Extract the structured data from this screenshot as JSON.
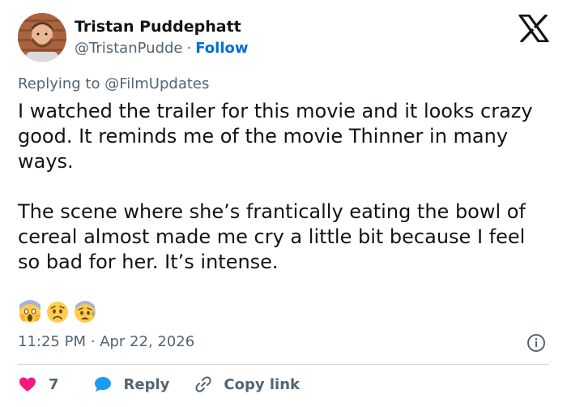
{
  "author": {
    "name": "Tristan Puddephatt",
    "handle": "@TristanPudde",
    "separator": "·",
    "follow_label": "Follow"
  },
  "reply_context": {
    "prefix": "Replying to",
    "mention": "@FilmUpdates"
  },
  "tweet": {
    "paragraph_1": "I watched the trailer for this movie and it looks crazy good. It reminds me of the movie Thinner in many ways.",
    "paragraph_2": "The scene where she’s frantically eating the bowl of cereal almost made me cry a little bit because I feel so bad for her. It’s intense.",
    "emojis": [
      "screaming-face",
      "worried-face",
      "anxious-face-with-sweat"
    ]
  },
  "meta": {
    "time": "11:25 PM",
    "separator": "·",
    "date": "Apr 22, 2026"
  },
  "actions": {
    "like_count": "7",
    "reply_label": "Reply",
    "copy_link_label": "Copy link"
  },
  "colors": {
    "accent": "#006fd6",
    "heart": "#f91880",
    "secondary_text": "#536471",
    "divider": "#cfd9de"
  },
  "icons": {
    "brand": "x-logo",
    "info": "info-icon",
    "like": "heart-icon",
    "reply": "reply-bubble-icon",
    "copy_link": "link-icon"
  }
}
